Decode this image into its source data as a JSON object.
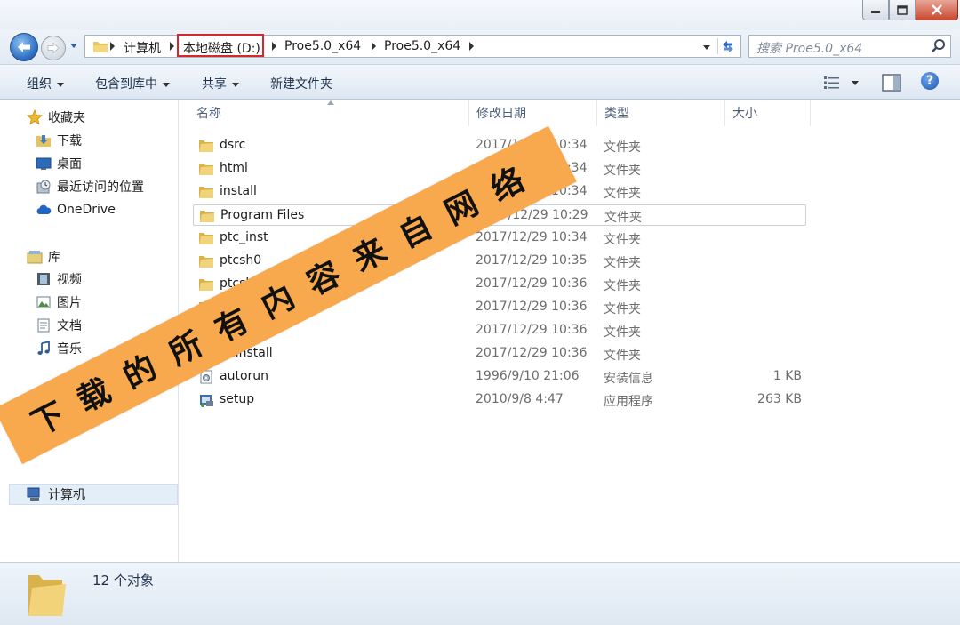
{
  "nav": {
    "breadcrumbs": [
      "计算机",
      "本地磁盘 (D:)",
      "Proe5.0_x64",
      "Proe5.0_x64"
    ],
    "search_placeholder": "搜索 Proe5.0_x64"
  },
  "toolbar": {
    "organize": "组织",
    "include_in_library": "包含到库中",
    "share": "共享",
    "new_folder": "新建文件夹"
  },
  "sidebar": {
    "favorites": "收藏夹",
    "downloads": "下载",
    "desktop": "桌面",
    "recent": "最近访问的位置",
    "onedrive": "OneDrive",
    "libraries": "库",
    "videos": "视频",
    "pictures": "图片",
    "documents": "文档",
    "music": "音乐",
    "computer": "计算机"
  },
  "columns": {
    "name": "名称",
    "date": "修改日期",
    "type": "类型",
    "size": "大小"
  },
  "files": [
    {
      "name": "dsrc",
      "date": "2017/12/29 10:34",
      "type": "文件夹",
      "size": "",
      "icon": "folder-icon"
    },
    {
      "name": "html",
      "date": "2017/12/29 10:34",
      "type": "文件夹",
      "size": "",
      "icon": "folder-icon"
    },
    {
      "name": "install",
      "date": "2017/12/29 10:34",
      "type": "文件夹",
      "size": "",
      "icon": "folder-icon"
    },
    {
      "name": "Program Files",
      "date": "2017/12/29 10:29",
      "type": "文件夹",
      "size": "",
      "icon": "folder-icon"
    },
    {
      "name": "ptc_inst",
      "date": "2017/12/29 10:34",
      "type": "文件夹",
      "size": "",
      "icon": "folder-icon"
    },
    {
      "name": "ptcsh0",
      "date": "2017/12/29 10:35",
      "type": "文件夹",
      "size": "",
      "icon": "folder-icon"
    },
    {
      "name": "ptcsh1",
      "date": "2017/12/29 10:36",
      "type": "文件夹",
      "size": "",
      "icon": "folder-icon"
    },
    {
      "name": "",
      "date": "2017/12/29 10:36",
      "type": "文件夹",
      "size": "",
      "icon": "folder-icon"
    },
    {
      "name": "",
      "date": "2017/12/29 10:36",
      "type": "文件夹",
      "size": "",
      "icon": "folder-icon"
    },
    {
      "name": "uninstall",
      "date": "2017/12/29 10:36",
      "type": "文件夹",
      "size": "",
      "icon": "folder-icon"
    },
    {
      "name": "autorun",
      "date": "1996/9/10 21:06",
      "type": "安装信息",
      "size": "1 KB",
      "icon": "settings-file-icon"
    },
    {
      "name": "setup",
      "date": "2010/9/8 4:47",
      "type": "应用程序",
      "size": "263 KB",
      "icon": "setup-app-icon"
    }
  ],
  "selected_index": 3,
  "status": {
    "count_text": "12 个对象"
  },
  "watermark": {
    "text": "下载的所有内容来自网络",
    "color": "#f8a84d"
  }
}
